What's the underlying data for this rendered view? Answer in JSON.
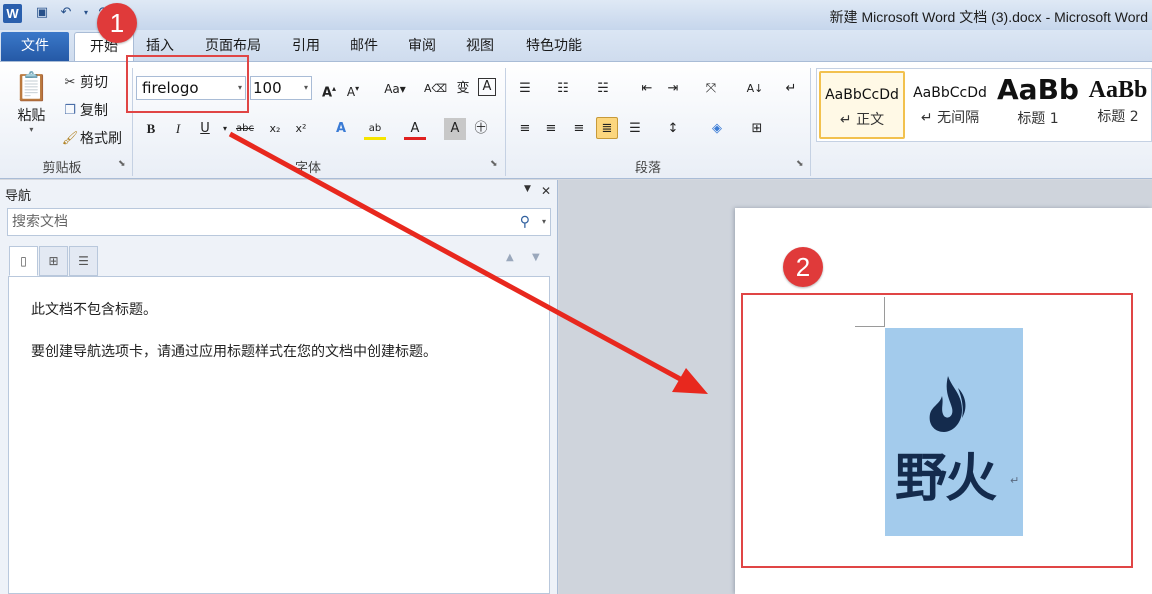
{
  "window": {
    "title": "新建 Microsoft Word 文档 (3).docx - Microsoft Word",
    "app_icon": "W"
  },
  "tabs": {
    "file": "文件",
    "items": [
      "开始",
      "插入",
      "页面布局",
      "引用",
      "邮件",
      "审阅",
      "视图",
      "特色功能"
    ]
  },
  "clipboard": {
    "paste": "粘贴",
    "cut": "剪切",
    "copy": "复制",
    "format_painter": "格式刷",
    "group_label": "剪贴板"
  },
  "font": {
    "name": "firelogo",
    "size": "100",
    "group_label": "字体"
  },
  "paragraph": {
    "group_label": "段落"
  },
  "styles": {
    "items": [
      {
        "sample": "AaBbCcDd",
        "name": "↵ 正文"
      },
      {
        "sample": "AaBbCcDd",
        "name": "↵ 无间隔"
      },
      {
        "sample": "AaBb",
        "name": "标题 1"
      },
      {
        "sample": "AaBb",
        "name": "标题 2"
      }
    ]
  },
  "navigation": {
    "title": "导航",
    "search_placeholder": "搜索文档",
    "message_1": "此文档不包含标题。",
    "message_2": "要创建导航选项卡，请通过应用标题样式在您的文档中创建标题。"
  },
  "document": {
    "logo_text": "野火",
    "paragraph_mark": "↵"
  },
  "annotations": {
    "badge_1": "1",
    "badge_2": "2",
    "color": "#e03a3a"
  }
}
